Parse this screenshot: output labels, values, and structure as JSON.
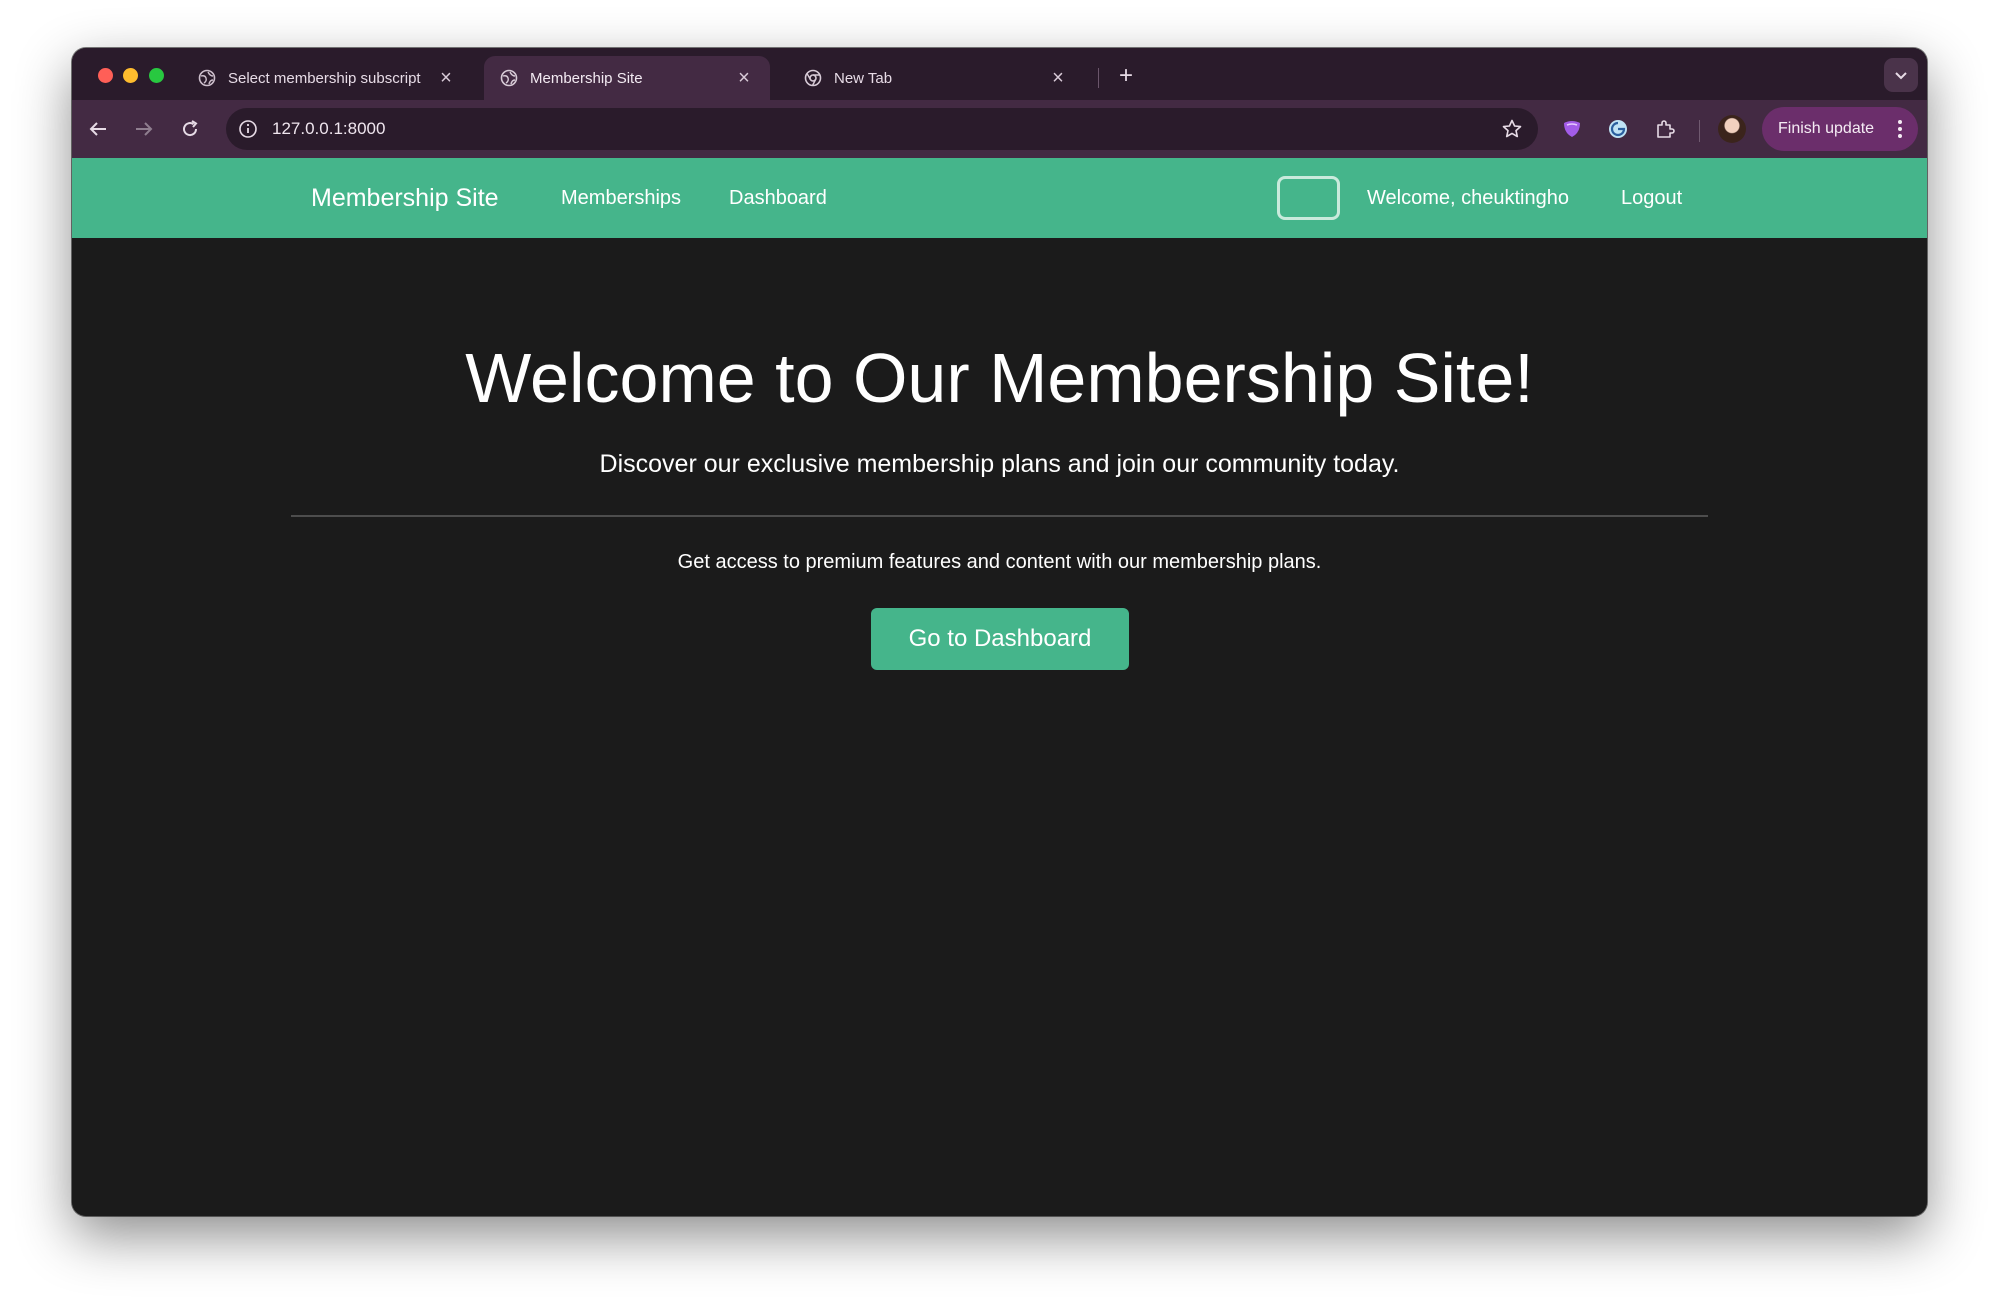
{
  "browser": {
    "tabs": [
      {
        "title": "Select membership subscript",
        "active": false,
        "icon": "globe-icon"
      },
      {
        "title": "Membership Site",
        "active": true,
        "icon": "globe-icon"
      },
      {
        "title": "New Tab",
        "active": false,
        "icon": "chrome-icon"
      }
    ],
    "new_tab_label": "+",
    "close_glyph": "×",
    "url": "127.0.0.1:8000",
    "finish_update_label": "Finish update",
    "colors": {
      "tabstrip": "#2a1b2b",
      "toolbar": "#432a43",
      "finish_button": "#6b2e6b"
    }
  },
  "site": {
    "brand": "Membership Site",
    "nav": {
      "memberships": "Memberships",
      "dashboard": "Dashboard"
    },
    "theme_toggle_icon": "moon-icon",
    "welcome": "Welcome, cheuktingho",
    "logout": "Logout",
    "colors": {
      "accent": "#45b58b",
      "background": "#1b1b1b"
    }
  },
  "hero": {
    "title": "Welcome to Our Membership Site!",
    "subtitle": "Discover our exclusive membership plans and join our community today.",
    "text": "Get access to premium features and content with our membership plans.",
    "cta_label": "Go to Dashboard"
  }
}
